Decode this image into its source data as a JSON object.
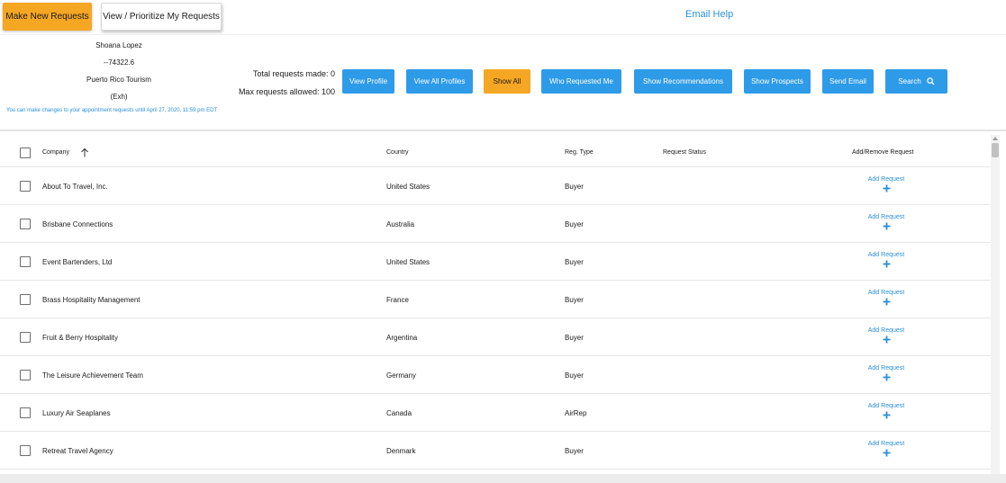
{
  "tabs": {
    "make_new": "Make New Requests",
    "view_prioritize": "View / Prioritize My Requests",
    "email_help": "Email Help"
  },
  "user": {
    "name": "Shoana Lopez",
    "id": "--74322.6",
    "organization": "Puerto Rico Tourism",
    "role": "(Exh)"
  },
  "notice": "You can make changes to your appointment requests until April 27, 2020, 11:59 pm EDT",
  "counts": {
    "total_label": "Total requests made: 0",
    "max_label": "Max requests allowed: 100"
  },
  "actions": [
    {
      "label": "View Profile"
    },
    {
      "label": "View All Profiles"
    },
    {
      "label": "Show All"
    },
    {
      "label": "Who Requested Me"
    },
    {
      "label": "Show Recommendations"
    },
    {
      "label": "Show Prospects"
    },
    {
      "label": "Send Email"
    },
    {
      "label": "Search"
    }
  ],
  "table": {
    "headers": {
      "company": "Company",
      "country": "Country",
      "reg_type": "Reg. Type",
      "status": "Request Status",
      "add_remove": "Add/Remove Request"
    },
    "add_label": "Add Request",
    "rows": [
      {
        "company": "About To Travel, Inc.",
        "country": "United States",
        "type": "Buyer",
        "status": ""
      },
      {
        "company": "Brisbane Connections",
        "country": "Australia",
        "type": "Buyer",
        "status": ""
      },
      {
        "company": "Event Bartenders, Ltd",
        "country": "United States",
        "type": "Buyer",
        "status": ""
      },
      {
        "company": "Brass Hospitality Management",
        "country": "France",
        "type": "Buyer",
        "status": ""
      },
      {
        "company": "Fruit & Berry Hospitality",
        "country": "Argentina",
        "type": "Buyer",
        "status": ""
      },
      {
        "company": "The Leisure Achievement Team",
        "country": "Germany",
        "type": "Buyer",
        "status": ""
      },
      {
        "company": "Luxury Air Seaplanes",
        "country": "Canada",
        "type": "AirRep",
        "status": ""
      },
      {
        "company": "Retreat Travel Agency",
        "country": "Denmark",
        "type": "Buyer",
        "status": ""
      }
    ]
  },
  "colors": {
    "accent_orange": "#f5a623",
    "button_blue": "#2e9be8",
    "link_blue": "#2a8fd8"
  }
}
